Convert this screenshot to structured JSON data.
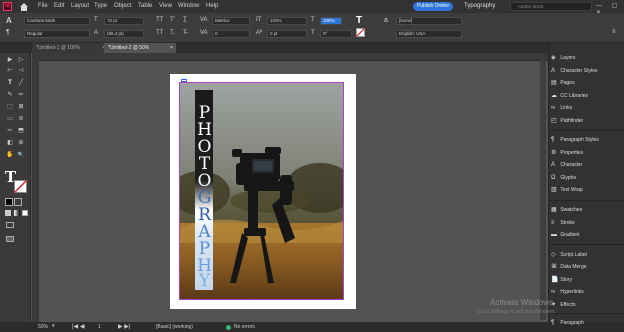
{
  "menu": {
    "app_icon": "Id",
    "items": [
      "File",
      "Edit",
      "Layout",
      "Type",
      "Object",
      "Table",
      "View",
      "Window",
      "Help"
    ],
    "publish": "Publish Online",
    "workspace": "Typography",
    "search_placeholder": "Adobe Stock",
    "window_controls": "— ▢ ✕"
  },
  "controlbar": {
    "font_family": "Cambria Math",
    "font_style": "Regular",
    "font_size": "72 pt",
    "leading": "(86.4 pt)",
    "kerning": "Metrics",
    "tracking": "0",
    "horizontal_scale": "100%",
    "baseline": "0 pt",
    "vertical_scale": "100%",
    "skew": "0°",
    "char_style": "[None]",
    "language": "English: USA",
    "tt_buttons": [
      "TT",
      "T'",
      "T,",
      "TT",
      "T",
      "T̲",
      "T̶"
    ]
  },
  "tabs": [
    {
      "label": "*Untitled-1 @ 100%",
      "close": "×"
    },
    {
      "label": "*Untitled-2 @ 50%",
      "close": "×"
    }
  ],
  "tools": [
    "▶",
    "▷",
    "⊢",
    "⊣",
    "T",
    "╱",
    "✎",
    "✏",
    "⬚",
    "⊠",
    "▭",
    "⊘",
    "✂",
    "⬒",
    "◧",
    "⊕",
    "✋",
    "🔍"
  ],
  "page_text": {
    "letters": [
      "P",
      "H",
      "O",
      "T",
      "O",
      "G",
      "R",
      "A",
      "P",
      "H",
      "Y"
    ],
    "colors": [
      "#ffffff",
      "#ffffff",
      "#ffffff",
      "#ffffff",
      "#ffffff",
      "#3b6fb0",
      "#2f5fa8",
      "#4a80c8",
      "#5a90d0",
      "#6aa0d8",
      "#7ab0e0"
    ]
  },
  "panels": {
    "group1": [
      "Layers",
      "Character Styles",
      "Pages",
      "CC Libraries",
      "Links",
      "Pathfinder"
    ],
    "group2": [
      "Paragraph Styles",
      "Properties",
      "Character",
      "Glyphs",
      "Text Wrap"
    ],
    "group3": [
      "Swatches",
      "Stroke",
      "Gradient"
    ],
    "group4": [
      "Script Label",
      "Data Merge",
      "Story",
      "Hyperlinks",
      "Effects"
    ],
    "group5": [
      "Paragraph"
    ],
    "icons": [
      "◈",
      "A",
      "▤",
      "☁",
      "∞",
      "◰",
      "¶",
      "⚙",
      "A",
      "Ω",
      "▥",
      "▦",
      "≡",
      "▬",
      "◇",
      "⌘",
      "✉",
      "📄",
      "∞",
      "✦",
      "¶"
    ]
  },
  "status": {
    "zoom": "50%",
    "page": "1",
    "style": "[Basic] (working)",
    "errors": "No errors"
  },
  "watermark": {
    "title": "Activate Windows",
    "subtitle": "Go to Settings to activate Windows."
  },
  "colors": {
    "accent": "#2d75d6",
    "frame": "#b040c8",
    "status_ok": "#3cb371"
  }
}
